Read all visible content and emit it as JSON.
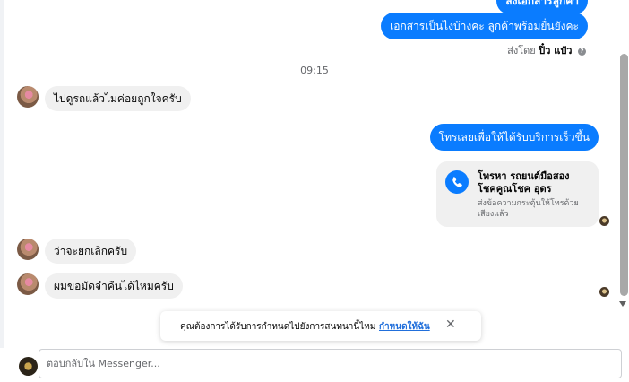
{
  "messages": {
    "top_partial": "ส่งเอกสารลูกค้า",
    "out_docs": "เอกสารเป็นไงบ้างคะ ลูกค้าพร้อมยื่นยังคะ",
    "sent_by_prefix": "ส่งโดย",
    "sent_by_name": "ปิ๋ว แป๋ว",
    "time": "09:15",
    "in_1": "ไปดูรถแล้วไม่ค่อยถูกใจครับ",
    "out_call": "โทรเลยเพื่อให้ได้รับบริการเร็วขึ้น",
    "in_2": "ว่าจะยกเลิกครับ",
    "in_3": "ผมขอมัดจำคืนได้ไหมครับ"
  },
  "call_card": {
    "title": "โทรหา รถยนต์มือสอง โชคคูณโชค อุดร",
    "subtitle": "ส่งข้อความกระตุ้นให้โทรด้วยเสียงแล้ว"
  },
  "toast": {
    "text": "คุณต้องการได้รับการกำหนดไปยังการสนทนานี้ไหม",
    "link": "กำหนดให้ฉัน",
    "close": "✕"
  },
  "compose": {
    "placeholder": "ตอบกลับใน Messenger..."
  },
  "colors": {
    "outgoing_bubble": "#0a7cff",
    "incoming_bubble": "#f0f0f0",
    "link": "#216fdb"
  },
  "icons": {
    "help": "help-icon",
    "phone": "phone-icon",
    "close": "close-icon"
  }
}
